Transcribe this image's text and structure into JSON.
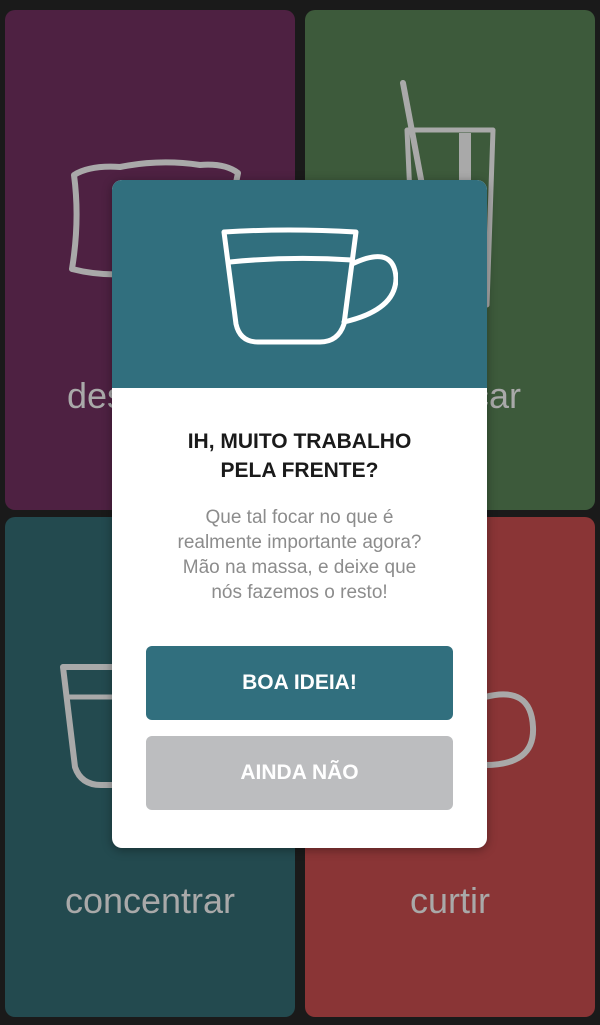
{
  "tiles": [
    {
      "id": "tl",
      "label": "descansar",
      "color": "#4e2142",
      "icon": "pillow-icon"
    },
    {
      "id": "tr",
      "label": "refrescar",
      "color": "#3d5a3b",
      "icon": "glass-with-straw-icon"
    },
    {
      "id": "bl",
      "label": "concentrar",
      "color": "#234a4f",
      "icon": "coffee-cup-icon"
    },
    {
      "id": "br",
      "label": "curtir",
      "color": "#8a3536",
      "icon": "mug-icon"
    }
  ],
  "modal": {
    "icon": "coffee-cup-icon",
    "title_line1": "IH, MUITO TRABALHO",
    "title_line2": "PELA FRENTE?",
    "message_lines": [
      "Que tal focar no que é",
      "realmente importante agora?",
      "Mão na massa, e deixe que",
      "nós fazemos o resto!"
    ],
    "primary_button": "BOA IDEIA!",
    "secondary_button": "AINDA NÃO"
  },
  "colors": {
    "accent": "#316f7e",
    "secondary_button": "#bcbdbf",
    "background": "#1a1a1a"
  }
}
